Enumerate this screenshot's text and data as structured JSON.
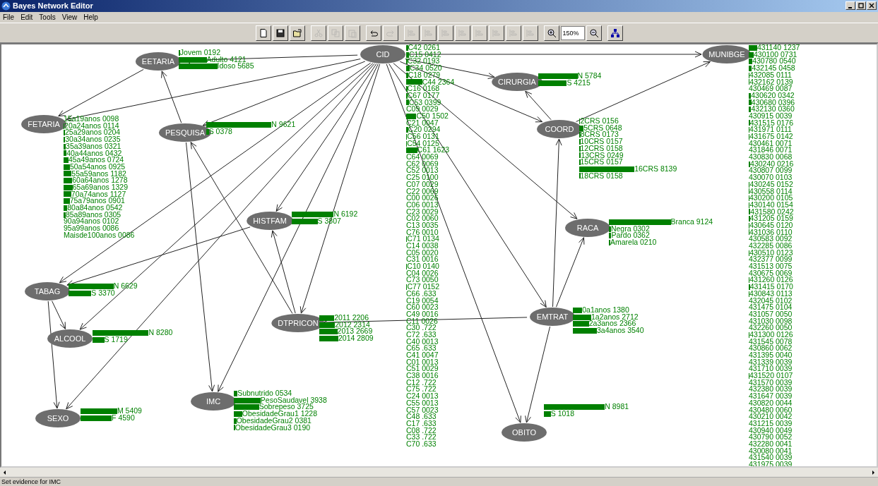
{
  "window": {
    "title": "Bayes Network Editor"
  },
  "menu": [
    "File",
    "Edit",
    "Tools",
    "View",
    "Help"
  ],
  "toolbar": {
    "buttons": [
      {
        "kind": "new",
        "disabled": false
      },
      {
        "kind": "save",
        "disabled": false
      },
      {
        "kind": "open",
        "disabled": false
      },
      {
        "kind": "cut",
        "disabled": true
      },
      {
        "kind": "copy",
        "disabled": true
      },
      {
        "kind": "paste",
        "disabled": true
      },
      {
        "kind": "undo",
        "disabled": false
      },
      {
        "kind": "redo",
        "disabled": true
      },
      {
        "kind": "align",
        "disabled": true
      },
      {
        "kind": "align",
        "disabled": true
      },
      {
        "kind": "align",
        "disabled": true
      },
      {
        "kind": "align",
        "disabled": true
      },
      {
        "kind": "align",
        "disabled": true
      },
      {
        "kind": "align",
        "disabled": true
      },
      {
        "kind": "align",
        "disabled": true
      },
      {
        "kind": "align",
        "disabled": true
      },
      {
        "kind": "zoom-in",
        "disabled": false
      },
      {
        "kind": "zoom-field",
        "value": "150%"
      },
      {
        "kind": "zoom-out",
        "disabled": false
      },
      {
        "kind": "layout",
        "disabled": false
      }
    ]
  },
  "nodes": [
    {
      "name": "EETARIA",
      "states": [
        "Jovem 0192",
        "Adulto 4121",
        "Idoso 5685"
      ]
    },
    {
      "name": "CID",
      "states": [
        "C42 0261",
        "C15 0412",
        "C32 0193",
        "C34 0520",
        "C18 0279",
        "C44 2364",
        "C16 0168",
        "C67 0177",
        "C53 0399",
        "C09 0029",
        "C50 1502",
        "C21 0047",
        "C20 0294",
        "C56 0131",
        "C54 0125",
        "C61 1623",
        "C64 0069",
        "C62 0069",
        "C52 0013",
        "C25 0100",
        "C07 0029",
        "C22 0069",
        "C00 0026",
        "C06 0013",
        "C23 0029",
        "C02 0060",
        "C13 0035",
        "C76 0010",
        "C71 0134",
        "C14 0038",
        "C05 0020",
        "C31 0016",
        "C10 0140",
        "C04 0026",
        "C73 0050",
        "C77 0152",
        "C66 .633",
        "C19 0054",
        "C60 0023",
        "C49 0016",
        "C11 0026",
        "C30 .722",
        "C72 .633",
        "C40 0013",
        "C65 .633",
        "C41 0047",
        "C01 0013",
        "C51 0029",
        "C38 0016",
        "C12 .722",
        "C75 .722",
        "C24 0013",
        "C55 0013",
        "C57 0023",
        "C48 .633",
        "C17 .633",
        "C08 .722",
        "C33 .722",
        "C70 .633"
      ]
    },
    {
      "name": "MUNIBGE",
      "states": [
        "431140 1237",
        "430100 0731",
        "430780 0540",
        "432145 0458",
        "432085 0111",
        "432162 0139",
        "430469 0087",
        "430620 0342",
        "430680 0396",
        "432130 0360",
        "430915 0039",
        "431515 0176",
        "431971 0111",
        "431675 0142",
        "430461 0071",
        "431846 0071",
        "430830 0068",
        "430240 0216",
        "430807 0099",
        "430070 0103",
        "430245 0152",
        "430558 0114",
        "430200 0105",
        "430140 0154",
        "431580 0242",
        "431205 0159",
        "430645 0120",
        "431036 0110",
        "430583 0092",
        "432285 0086",
        "430510 0123",
        "432377 0099",
        "431513 0075",
        "430675 0069",
        "431260 0126",
        "431415 0170",
        "430843 0113",
        "432045 0102",
        "431475 0104",
        "431057 0050",
        "431030 0098",
        "432260 0050",
        "431300 0126",
        "431545 0078",
        "430860 0062",
        "431395 0040",
        "431339 0039",
        "431710 0039",
        "431520 0107",
        "431570 0039",
        "432380 0039",
        "431647 0039",
        "430820 0044",
        "430480 0060",
        "430210 0042",
        "431215 0039",
        "430940 0049",
        "430790 0052",
        "432280 0041",
        "430080 0041",
        "431540 0039",
        "431975 0039"
      ]
    },
    {
      "name": "FETARIA",
      "states": [
        "15a19anos 0098",
        "20a24anos 0114",
        "25a29anos 0204",
        "30a34anos 0235",
        "35a39anos 0321",
        "40a44anos 0432",
        "45a49anos 0724",
        "50a54anos 0925",
        "55a59anos 1182",
        "60a64anos 1278",
        "65a69anos 1329",
        "70a74anos 1127",
        "75a79anos 0901",
        "80a84anos 0542",
        "85a89anos 0305",
        "90a94anos 0102",
        "95a99anos 0086",
        "Maisde100anos 0086"
      ]
    },
    {
      "name": "PESQUISA",
      "states": [
        "N 9621",
        "S 0378"
      ]
    },
    {
      "name": "CIRURGIA",
      "states": [
        "N 5784",
        "S 4215"
      ]
    },
    {
      "name": "COORD",
      "states": [
        "2CRS 0156",
        "5CRS 0648",
        "8CRS 0173",
        "10CRS 0157",
        "12CRS 0158",
        "13CRS 0249",
        "15CRS 0157",
        "16CRS 8139",
        "18CRS 0158"
      ]
    },
    {
      "name": "HISTFAM",
      "states": [
        "N 6192",
        "S 3807"
      ]
    },
    {
      "name": "RACA",
      "states": [
        "Branca 9124",
        "Negra 0302",
        "Pardo 0362",
        "Amarela 0210"
      ]
    },
    {
      "name": "TABAG",
      "states": [
        "N 6629",
        "S 3370"
      ]
    },
    {
      "name": "ALCOOL",
      "states": [
        "N 8280",
        "S 1719"
      ]
    },
    {
      "name": "DTPRICON",
      "states": [
        "2011 2206",
        "2012 2314",
        "2013 2669",
        "2014 2809"
      ]
    },
    {
      "name": "EMTRAT",
      "states": [
        "0a1anos 1380",
        "1a2anos 2712",
        "2a3anos 2366",
        "3a4anos 3540"
      ]
    },
    {
      "name": "IMC",
      "states": [
        "Subnutrido 0534",
        "PesoSaudavel 3938",
        "Sobrepeso 3725",
        "ObesidadeGrau1 1228",
        "ObesidadeGrau2 0381",
        "ObesidadeGrau3 0190"
      ]
    },
    {
      "name": "SEXO",
      "states": [
        "M 5409",
        "F 4590"
      ]
    },
    {
      "name": "OBITO",
      "states": [
        "N 8981",
        "S 1018"
      ]
    }
  ],
  "status_bar": "Set evidence for IMC"
}
